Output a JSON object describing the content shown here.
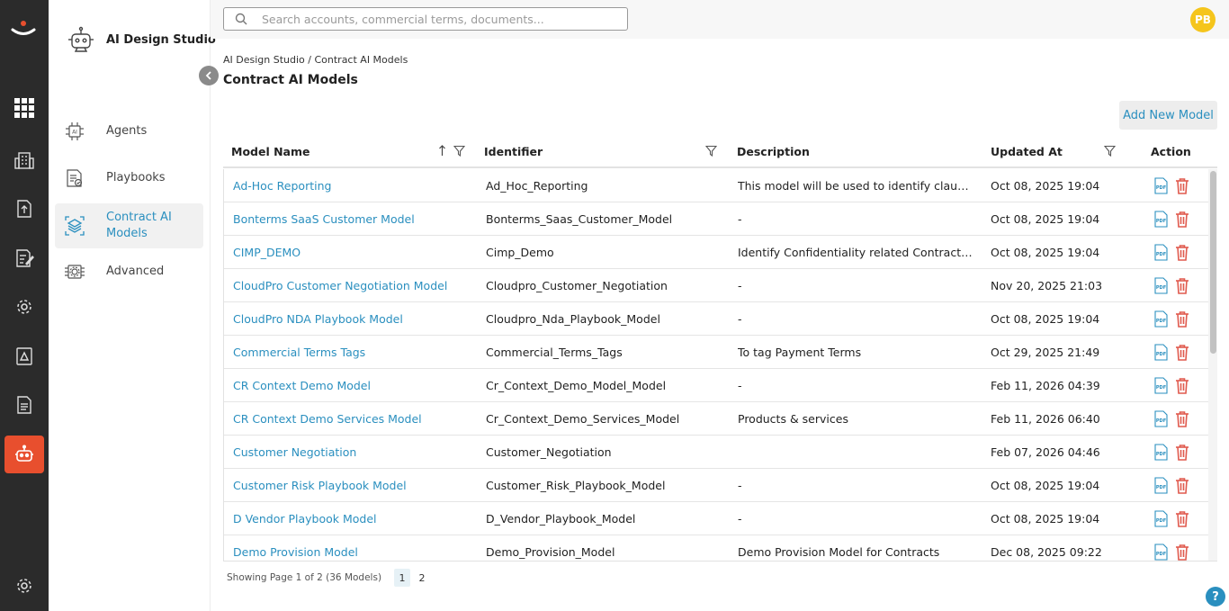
{
  "rail": {
    "items": [
      {
        "icon": "grid-icon",
        "active": false
      },
      {
        "icon": "building-icon",
        "active": false
      },
      {
        "icon": "upload-document-icon",
        "active": false
      },
      {
        "icon": "edit-document-icon",
        "active": false
      },
      {
        "icon": "settings-gear-icon",
        "active": false
      },
      {
        "icon": "warning-document-icon",
        "active": false
      },
      {
        "icon": "report-document-icon",
        "active": false
      },
      {
        "icon": "robot-icon",
        "active": true
      }
    ],
    "bottom_icon": "settings-gear-icon",
    "active_color": "#e84f2e"
  },
  "sidebar": {
    "title": "AI Design Studio",
    "items": [
      {
        "label": "Agents",
        "icon": "ai-chip-icon",
        "active": false
      },
      {
        "label": "Playbooks",
        "icon": "playbook-icon",
        "active": false
      },
      {
        "label": "Contract AI Models",
        "icon": "layers-icon",
        "active": true
      },
      {
        "label": "Advanced",
        "icon": "processor-icon",
        "active": false
      }
    ]
  },
  "header": {
    "search_placeholder": "Search accounts, commercial terms, documents...",
    "avatar_initials": "PB"
  },
  "breadcrumb": "AI Design Studio / Contract AI Models",
  "page_title": "Contract AI Models",
  "add_button": "Add New Model",
  "table": {
    "columns": [
      "Model Name",
      "Identifier",
      "Description",
      "Updated At",
      "Action"
    ],
    "rows": [
      {
        "name": "Ad-Hoc Reporting",
        "identifier": "Ad_Hoc_Reporting",
        "description": "This model will be used to identify clauses ...",
        "updated": "Oct 08, 2025 19:04"
      },
      {
        "name": "Bonterms SaaS Customer Model",
        "identifier": "Bonterms_Saas_Customer_Model",
        "description": "-",
        "updated": "Oct 08, 2025 19:04"
      },
      {
        "name": "CIMP_DEMO",
        "identifier": "Cimp_Demo",
        "description": "Identify Confidentiality related Contract R...",
        "updated": "Oct 08, 2025 19:04"
      },
      {
        "name": "CloudPro Customer Negotiation Model",
        "identifier": "Cloudpro_Customer_Negotiation",
        "description": "-",
        "updated": "Nov 20, 2025 21:03"
      },
      {
        "name": "CloudPro NDA Playbook Model",
        "identifier": "Cloudpro_Nda_Playbook_Model",
        "description": "-",
        "updated": "Oct 08, 2025 19:04"
      },
      {
        "name": "Commercial Terms Tags",
        "identifier": "Commercial_Terms_Tags",
        "description": "To tag Payment Terms",
        "updated": "Oct 29, 2025 21:49"
      },
      {
        "name": "CR Context Demo Model",
        "identifier": "Cr_Context_Demo_Model_Model",
        "description": "-",
        "updated": "Feb 11, 2026 04:39"
      },
      {
        "name": "CR Context Demo Services Model",
        "identifier": "Cr_Context_Demo_Services_Model",
        "description": "Products & services",
        "updated": "Feb 11, 2026 06:40"
      },
      {
        "name": "Customer Negotiation",
        "identifier": "Customer_Negotiation",
        "description": "",
        "updated": "Feb 07, 2026 04:46"
      },
      {
        "name": "Customer Risk Playbook Model",
        "identifier": "Customer_Risk_Playbook_Model",
        "description": "-",
        "updated": "Oct 08, 2025 19:04"
      },
      {
        "name": "D Vendor Playbook Model",
        "identifier": "D_Vendor_Playbook_Model",
        "description": "-",
        "updated": "Oct 08, 2025 19:04"
      },
      {
        "name": "Demo Provision Model",
        "identifier": "Demo_Provision_Model",
        "description": "Demo Provision Model for Contracts",
        "updated": "Dec 08, 2025 09:22"
      }
    ],
    "sort_column": "Model Name",
    "sort_direction": "ascending"
  },
  "pagination": {
    "summary": "Showing Page 1 of 2 (36 Models)",
    "pages": [
      "1",
      "2"
    ],
    "current": "1"
  },
  "help_label": "?",
  "colors": {
    "link": "#2a8fbf",
    "delete": "#e05a4e",
    "rail": "#2b2b2b",
    "avatar": "#f5c51c"
  }
}
